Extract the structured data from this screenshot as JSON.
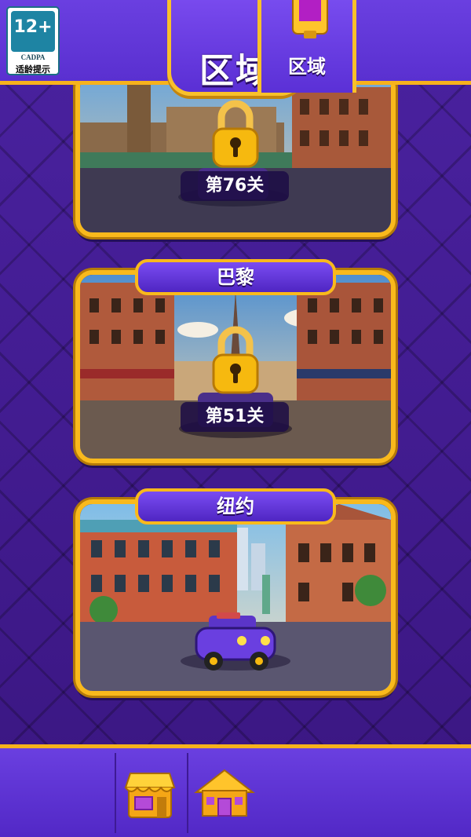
{
  "header": {
    "title": "区域"
  },
  "age_rating": {
    "rating": "12+",
    "org": "CADPA",
    "tip": "适龄提示"
  },
  "areas": [
    {
      "name": "",
      "level_label": "第76关",
      "locked": true
    },
    {
      "name": "巴黎",
      "level_label": "第51关",
      "locked": true
    },
    {
      "name": "纽约",
      "level_label": "",
      "locked": false
    }
  ],
  "bottom_nav": {
    "items": [
      {
        "icon": "shop-icon",
        "label": ""
      },
      {
        "icon": "house-icon",
        "label": ""
      },
      {
        "icon": "area-book-icon",
        "label": "区域",
        "active": true
      }
    ]
  },
  "colors": {
    "gold": "#f9b91c",
    "purple": "#5a30d0",
    "dark_purple": "#3d1a86"
  }
}
